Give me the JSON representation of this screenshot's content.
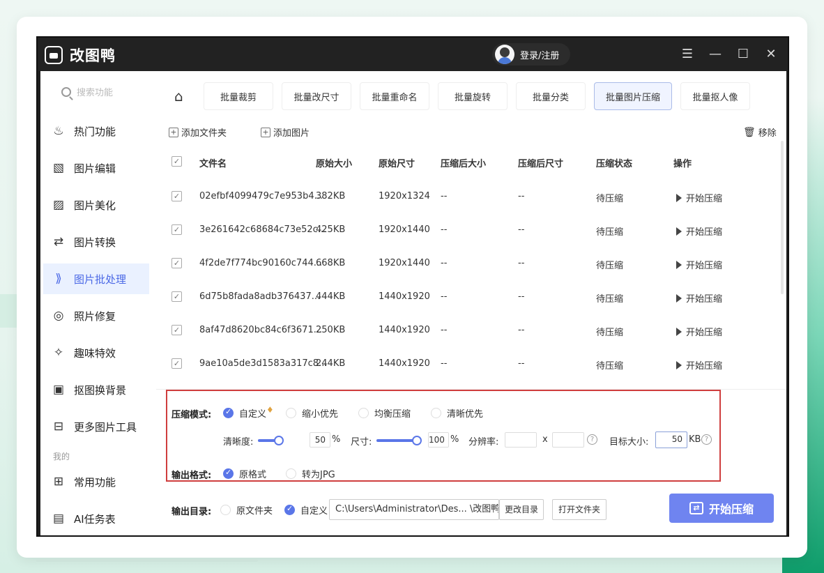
{
  "app": {
    "title": "改图鸭",
    "login": "登录/注册"
  },
  "sidebar": {
    "search_placeholder": "搜索功能",
    "items": [
      {
        "label": "热门功能",
        "icon": "flame-icon"
      },
      {
        "label": "图片编辑",
        "icon": "image-edit-icon"
      },
      {
        "label": "图片美化",
        "icon": "image-beautify-icon"
      },
      {
        "label": "图片转换",
        "icon": "convert-icon"
      },
      {
        "label": "图片批处理",
        "icon": "batch-icon",
        "active": true
      },
      {
        "label": "照片修复",
        "icon": "photo-repair-icon"
      },
      {
        "label": "趣味特效",
        "icon": "magic-wand-icon"
      },
      {
        "label": "抠图换背景",
        "icon": "cutout-icon"
      },
      {
        "label": "更多图片工具",
        "icon": "toolbox-icon"
      }
    ],
    "mine_label": "我的",
    "mine_items": [
      {
        "label": "常用功能",
        "icon": "grid-icon"
      },
      {
        "label": "AI任务表",
        "icon": "document-icon"
      }
    ]
  },
  "tabs": [
    "批量裁剪",
    "批量改尺寸",
    "批量重命名",
    "批量旋转",
    "批量分类",
    "批量图片压缩",
    "批量抠人像"
  ],
  "active_tab": "批量图片压缩",
  "toolbar": {
    "add_folder": "添加文件夹",
    "add_image": "添加图片",
    "remove": "移除"
  },
  "table": {
    "headers": [
      "文件名",
      "原始大小",
      "原始尺寸",
      "压缩后大小",
      "压缩后尺寸",
      "压缩状态",
      "操作"
    ],
    "rows": [
      {
        "name": "02efbf4099479c7e953b4...",
        "size": "382KB",
        "dim": "1920x1324",
        "csize": "--",
        "cdim": "--",
        "status": "待压缩",
        "action": "开始压缩"
      },
      {
        "name": "3e261642c68684c73e52c...",
        "size": "425KB",
        "dim": "1920x1440",
        "csize": "--",
        "cdim": "--",
        "status": "待压缩",
        "action": "开始压缩"
      },
      {
        "name": "4f2de7f774bc90160c744...",
        "size": "668KB",
        "dim": "1920x1440",
        "csize": "--",
        "cdim": "--",
        "status": "待压缩",
        "action": "开始压缩"
      },
      {
        "name": "6d75b8fada8adb376437...",
        "size": "444KB",
        "dim": "1440x1920",
        "csize": "--",
        "cdim": "--",
        "status": "待压缩",
        "action": "开始压缩"
      },
      {
        "name": "8af47d8620bc84c6f3671...",
        "size": "250KB",
        "dim": "1440x1920",
        "csize": "--",
        "cdim": "--",
        "status": "待压缩",
        "action": "开始压缩"
      },
      {
        "name": "9ae10a5de3d1583a317c8...",
        "size": "244KB",
        "dim": "1440x1920",
        "csize": "--",
        "cdim": "--",
        "status": "待压缩",
        "action": "开始压缩"
      }
    ]
  },
  "compress": {
    "mode_label": "压缩模式:",
    "modes": [
      "自定义",
      "缩小优先",
      "均衡压缩",
      "清晰优先"
    ],
    "clarity_label": "清晰度:",
    "clarity_value": "50",
    "clarity_fraction": 0.5,
    "size_label": "尺寸:",
    "size_value": "100",
    "size_fraction": 1.0,
    "percent": "%",
    "resolution_label": "分辨率:",
    "x": "x",
    "target_label": "目标大小:",
    "target_value": "50",
    "target_unit": "KB",
    "format_label": "输出格式:",
    "formats": [
      "原格式",
      "转为JPG"
    ]
  },
  "output": {
    "dir_label": "输出目录:",
    "options": [
      "原文件夹",
      "自定义"
    ],
    "path": "C:\\Users\\Administrator\\Des... \\改图鸭",
    "change_dir": "更改目录",
    "open_folder": "打开文件夹",
    "start": "开始压缩"
  }
}
